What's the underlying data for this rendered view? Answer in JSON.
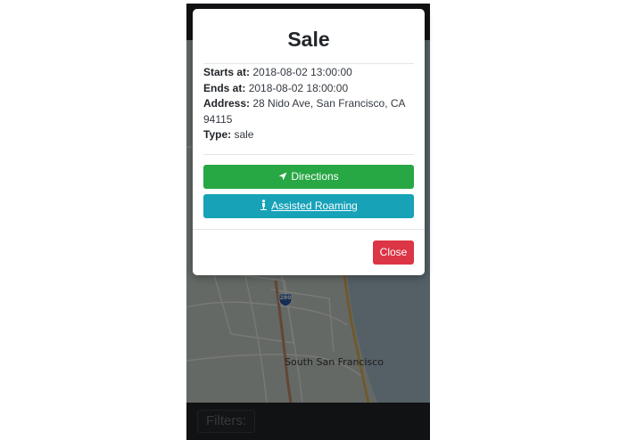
{
  "modal": {
    "title": "Sale",
    "details": [
      {
        "label": "Starts at:",
        "value": "2018-08-02 13:00:00"
      },
      {
        "label": "Ends at:",
        "value": "2018-08-02 18:00:00"
      },
      {
        "label": "Address:",
        "value": "28 Nido Ave, San Francisco, CA 94115"
      },
      {
        "label": "Type:",
        "value": "sale"
      }
    ],
    "directions_label": "Directions",
    "assisted_roaming_label": "Assisted Roaming",
    "close_label": "Close"
  },
  "map": {
    "place_label": "South San Francisco",
    "highway_shield": "280"
  },
  "bottom_bar": {
    "filters_label": "Filters:"
  },
  "colors": {
    "directions": "#28a745",
    "assisted_roaming": "#17a2b8",
    "close": "#dc3545"
  },
  "icons": {
    "directions": "location-arrow-icon",
    "assisted_roaming": "walking-person-icon"
  }
}
